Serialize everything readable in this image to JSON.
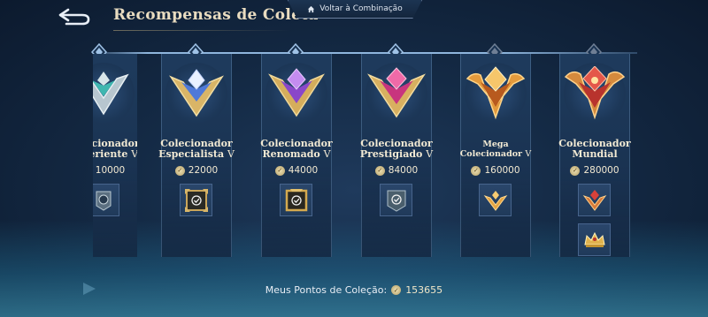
{
  "header": {
    "title": "Recompensas de Coleta",
    "combine_tab_label": "Voltar à Combinação"
  },
  "tiers": [
    {
      "line1": "Colecionador",
      "line2": "Experiente",
      "roman": "V",
      "points": "10000",
      "emblem": "silver-teal-emblem",
      "rewards": [
        "armor-frame-icon"
      ]
    },
    {
      "line1": "Colecionador",
      "line2": "Especialista",
      "roman": "V",
      "points": "22000",
      "emblem": "blue-gold-emblem",
      "rewards": [
        "gold-border-frame-check"
      ]
    },
    {
      "line1": "Colecionador",
      "line2": "Renomado",
      "roman": "V",
      "points": "44000",
      "emblem": "purple-emblem",
      "rewards": [
        "gold-frame-check"
      ]
    },
    {
      "line1": "Colecionador",
      "line2": "Prestigiado",
      "roman": "V",
      "points": "84000",
      "emblem": "magenta-emblem",
      "rewards": [
        "armor-frame-check"
      ]
    },
    {
      "line1": "Mega",
      "line2": "Colecionador",
      "roman": "V",
      "points": "160000",
      "emblem": "orange-gold-emblem",
      "rewards": [
        "gold-wing-emblem-icon"
      ]
    },
    {
      "line1": "Colecionador",
      "line2": "Mundial",
      "roman": "",
      "points": "280000",
      "emblem": "crimson-gold-emblem",
      "rewards": [
        "crimson-emblem-icon",
        "gold-crown-icon"
      ]
    }
  ],
  "footer": {
    "label": "Meus Pontos de Coleção:",
    "value": "153655"
  },
  "colors": {
    "background": "#142a45",
    "card": "#1e3b5d",
    "text_cream": "#f2ead4",
    "accent_gold": "#d4b468"
  }
}
